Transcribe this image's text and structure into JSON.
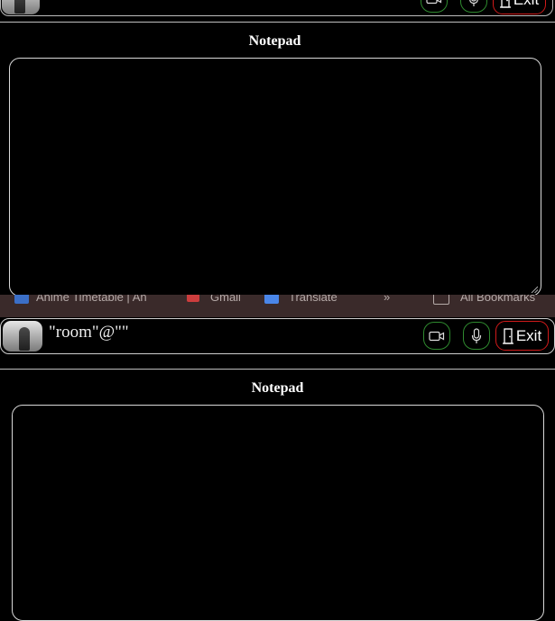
{
  "top_header": {
    "exit_label": "Exit"
  },
  "notepad_top": {
    "title": "Notepad"
  },
  "bookmarks": {
    "items": [
      "Anime Timetable | An",
      "Gmail",
      "Translate",
      "»",
      "All Bookmarks"
    ]
  },
  "main_header": {
    "room_label": "\"room\"@\"\"",
    "exit_label": "Exit"
  },
  "notepad_main": {
    "title": "Notepad"
  },
  "colors": {
    "background": "#000000",
    "border_light": "#d9d9d9",
    "media_button_border": "#2f8a2f",
    "exit_button_border": "#d11a1a",
    "bookmark_bar": "#3a2a2a"
  },
  "icons": {
    "camera": "video-camera-icon",
    "microphone": "microphone-icon",
    "exit": "door-exit-icon"
  }
}
